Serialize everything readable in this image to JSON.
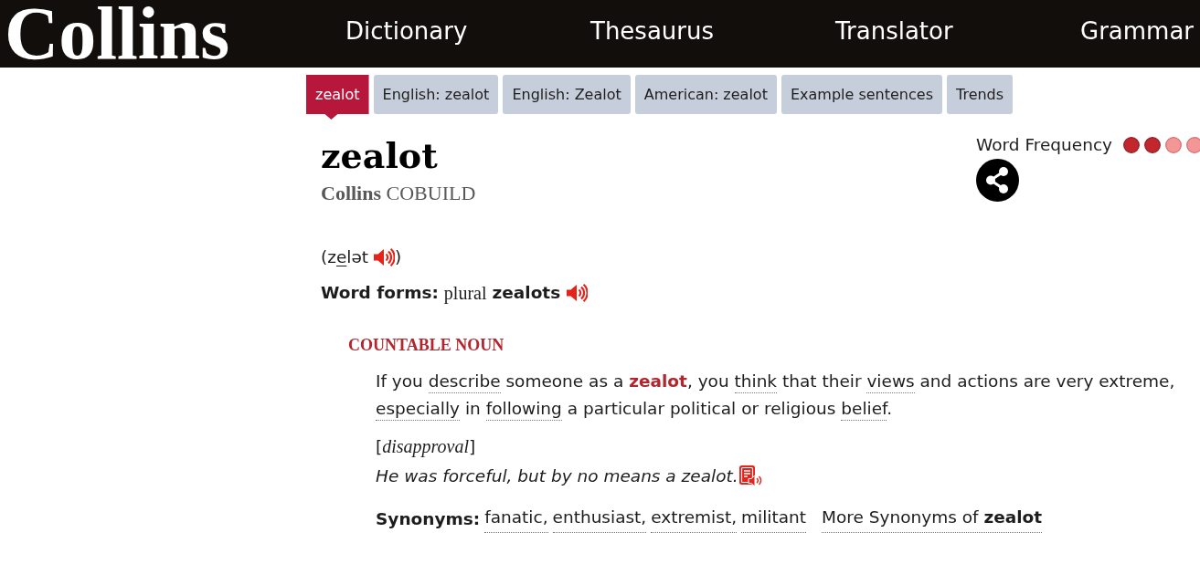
{
  "header": {
    "logo": "Collins",
    "nav": [
      "Dictionary",
      "Thesaurus",
      "Translator",
      "Grammar"
    ]
  },
  "tabs": [
    {
      "label": "zealot",
      "selected": true
    },
    {
      "label": "English: zealot",
      "selected": false
    },
    {
      "label": "English: Zealot",
      "selected": false
    },
    {
      "label": "American: zealot",
      "selected": false
    },
    {
      "label": "Example sentences",
      "selected": false
    },
    {
      "label": "Trends",
      "selected": false
    }
  ],
  "entry": {
    "headword": "zealot",
    "dictionary": "**Collins** COBUILD",
    "word_frequency": {
      "label": "Word Frequency",
      "stars": 2
    },
    "pronunciation": {
      "segments": [
        {
          "text": "(z",
          "stressed": false
        },
        {
          "text": "e",
          "stressed": true
        },
        {
          "text": "lət",
          "stressed": false
        }
      ],
      "close": ")"
    },
    "word_forms": {
      "label": "Word forms:",
      "grammar": "plural",
      "form": "zealots"
    }
  },
  "senses": [
    {
      "part_of_speech": "COUNTABLE NOUN",
      "definition": [
        {
          "text": "If you ",
          "kind": "text"
        },
        {
          "text": "describe",
          "kind": "link"
        },
        {
          "text": " someone as a ",
          "kind": "text"
        },
        {
          "text": "zealot",
          "kind": "headword"
        },
        {
          "text": ", you ",
          "kind": "text"
        },
        {
          "text": "think",
          "kind": "link"
        },
        {
          "text": " that their ",
          "kind": "text"
        },
        {
          "text": "views",
          "kind": "link"
        },
        {
          "text": " and actions are very extreme, ",
          "kind": "text"
        },
        {
          "text": "especially",
          "kind": "link"
        },
        {
          "text": " in ",
          "kind": "text"
        },
        {
          "text": "following",
          "kind": "link"
        },
        {
          "text": " a particular political or religious ",
          "kind": "text"
        },
        {
          "text": "belief",
          "kind": "link"
        },
        {
          "text": ".",
          "kind": "text"
        }
      ],
      "usage_note": "[*disapproval*]",
      "example": "He was forceful, but by no means a zealot.",
      "synonyms_label": "Synonyms:",
      "synonyms": [
        "fanatic,",
        "enthusiast,",
        "extremist,",
        "militant"
      ],
      "more_synonyms": "More Synonyms of **zealot**"
    }
  ]
}
